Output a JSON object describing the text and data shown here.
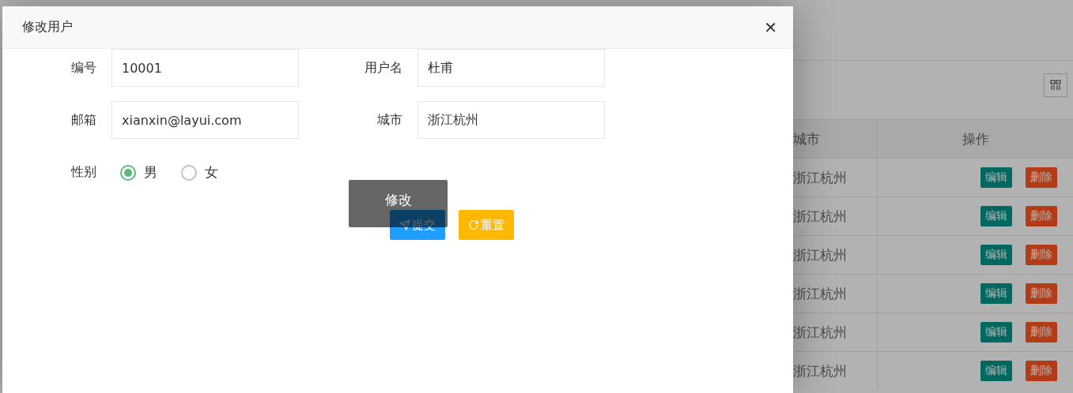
{
  "background": {
    "table": {
      "columns": [
        "城市",
        "操作"
      ],
      "rows": [
        {
          "city": "浙江杭州",
          "actions": [
            "编辑",
            "删除"
          ]
        },
        {
          "city": "浙江杭州",
          "actions": [
            "编辑",
            "删除"
          ]
        },
        {
          "city": "浙江杭州",
          "actions": [
            "编辑",
            "删除"
          ]
        },
        {
          "city": "浙江杭州",
          "actions": [
            "编辑",
            "删除"
          ]
        },
        {
          "city": "浙江杭州",
          "actions": [
            "编辑",
            "删除"
          ]
        },
        {
          "city": "浙江杭州",
          "actions": [
            "编辑",
            "删除"
          ]
        }
      ]
    }
  },
  "dialog": {
    "title": "修改用户",
    "close": "✕",
    "fields": [
      {
        "label": "编号",
        "value": "10001"
      },
      {
        "label": "用户名",
        "value": "杜甫"
      },
      {
        "label": "邮箱",
        "value": "xianxin@layui.com"
      },
      {
        "label": "城市",
        "value": "浙江杭州"
      }
    ],
    "gender": {
      "label": "性别",
      "options": [
        {
          "label": "男",
          "selected": true
        },
        {
          "label": "女",
          "selected": false
        }
      ]
    },
    "buttons": [
      {
        "kind": "submit",
        "label": "提交"
      },
      {
        "kind": "reset",
        "label": "重置"
      }
    ],
    "tooltip": "修改"
  }
}
